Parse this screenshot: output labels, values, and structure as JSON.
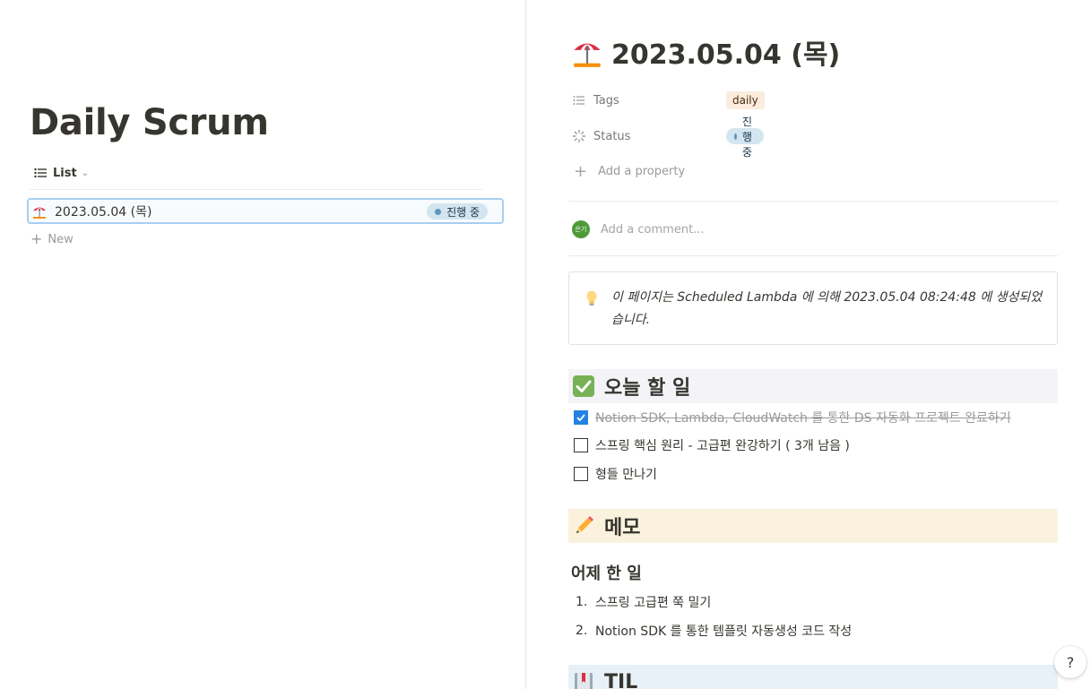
{
  "left": {
    "database_title": "Daily Scrum",
    "view": {
      "label": "List"
    },
    "rows": [
      {
        "title": "2023.05.04 (목)",
        "status": "진행 중"
      }
    ],
    "new_label": "New"
  },
  "page": {
    "title": "2023.05.04 (목)",
    "properties": {
      "tags": {
        "label": "Tags",
        "value": "daily"
      },
      "status": {
        "label": "Status",
        "value": "진행 중"
      },
      "add_label": "Add a property"
    },
    "comment": {
      "avatar_text": "은기",
      "placeholder": "Add a comment..."
    },
    "callout": {
      "text": "이 페이지는 Scheduled Lambda 에 의해 2023.05.04 08:24:48 에 생성되었습니다."
    },
    "todo_section": {
      "heading": "오늘 할 일",
      "items": [
        {
          "text": "Notion SDK, Lambda, CloudWatch 를 통한 DS 자동화 프로젝트 완료하기",
          "checked": true
        },
        {
          "text": "스프링 핵심 원리 - 고급편 완강하기 ( 3개 남음 )",
          "checked": false
        },
        {
          "text": "형들 만나기",
          "checked": false
        }
      ]
    },
    "memo_section": {
      "heading": "메모",
      "subheading": "어제 한 일",
      "list": [
        {
          "num": "1.",
          "text": "스프링 고급편 쭉 밀기"
        },
        {
          "num": "2.",
          "text": "Notion SDK 를 통한 템플릿 자동생성 코드 작성"
        }
      ]
    },
    "til_section": {
      "heading": "TIL"
    }
  },
  "help_label": "?",
  "colors": {
    "accent_blue": "#2383e2",
    "status_bg": "#d3e5ef",
    "tag_bg": "#fbecdd",
    "todo_heading_bg": "#f4f3f7",
    "memo_heading_bg": "#fbf2de",
    "til_heading_bg": "#e8f1f7"
  }
}
